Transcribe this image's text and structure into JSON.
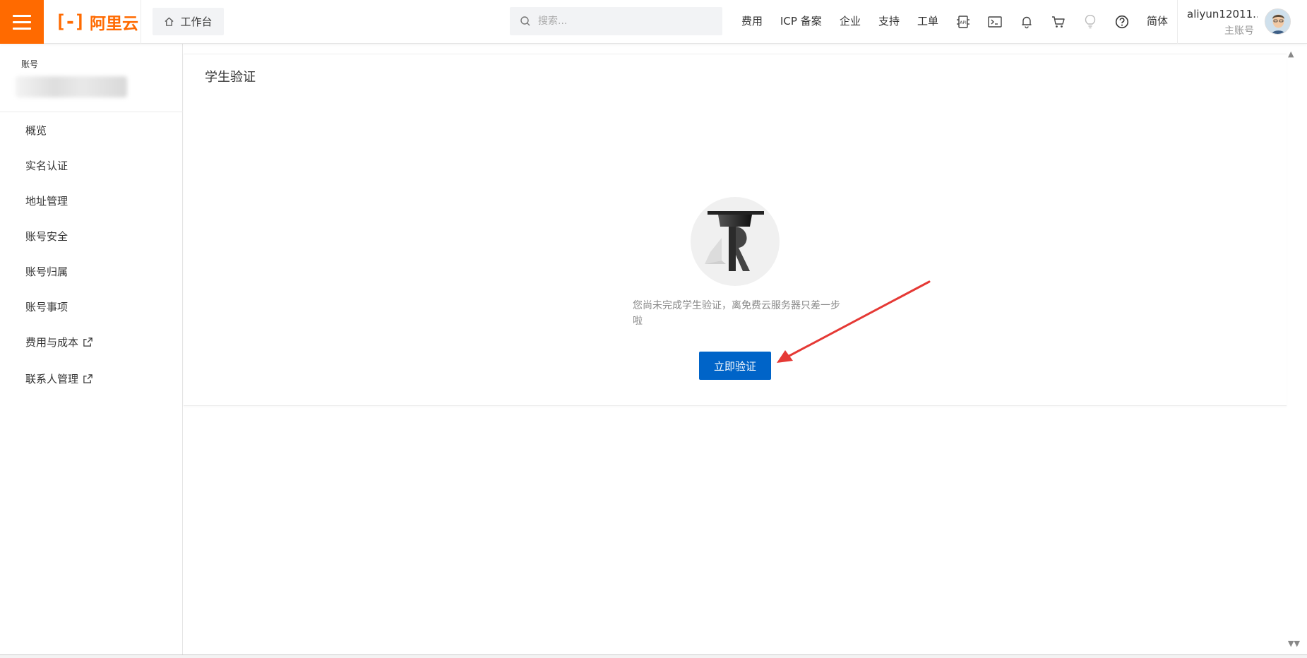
{
  "header": {
    "brand_name": "阿里云",
    "brand_mark": "[-]",
    "workbench_label": "工作台",
    "search_placeholder": "搜索...",
    "nav": {
      "cost": "费用",
      "icp": "ICP 备案",
      "enterprise": "企业",
      "support": "支持",
      "ticket": "工单",
      "language": "简体"
    },
    "icons": [
      "menu-icon",
      "home-icon",
      "search-icon",
      "api-icon",
      "terminal-icon",
      "bell-icon",
      "cart-icon",
      "lightbulb-icon",
      "help-icon"
    ],
    "user": {
      "name": "aliyun12011...",
      "role": "主账号"
    }
  },
  "sidebar": {
    "account_label": "账号",
    "items": [
      {
        "label": "概览",
        "external": false
      },
      {
        "label": "实名认证",
        "external": false
      },
      {
        "label": "地址管理",
        "external": false
      },
      {
        "label": "账号安全",
        "external": false
      },
      {
        "label": "账号归属",
        "external": false
      },
      {
        "label": "账号事项",
        "external": false
      },
      {
        "label": "费用与成本",
        "external": true
      },
      {
        "label": "联系人管理",
        "external": true
      }
    ]
  },
  "main": {
    "title": "学生验证",
    "message": "您尚未完成学生验证，离免费云服务器只差一步啦",
    "verify_button": "立即验证"
  },
  "colors": {
    "brand": "#ff6a00",
    "primary_button": "#0064c8",
    "annotation_arrow": "#e53935"
  }
}
